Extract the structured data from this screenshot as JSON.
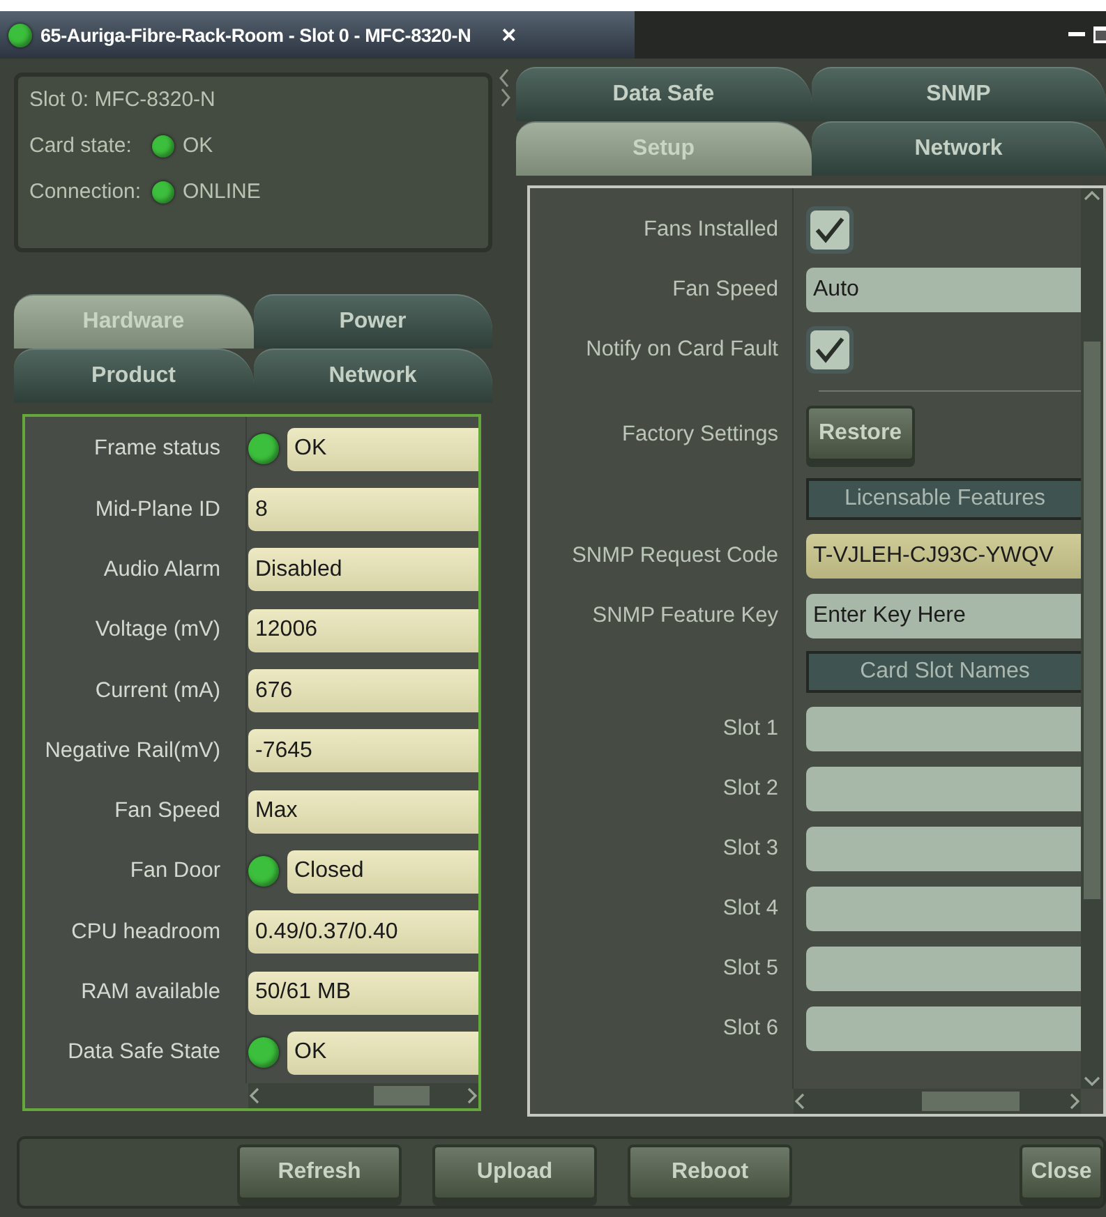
{
  "window": {
    "title": "65-Auriga-Fibre-Rack-Room - Slot 0 - MFC-8320-N",
    "ok": true,
    "close": "×"
  },
  "card_info": {
    "title": "Slot 0: MFC-8320-N",
    "items": [
      {
        "label": "Card state:",
        "value": "OK",
        "ok": true
      },
      {
        "label": "Connection:",
        "value": "ONLINE",
        "ok": true
      }
    ]
  },
  "left_tabs": [
    [
      {
        "label": "Hardware",
        "selected": true
      },
      {
        "label": "Power",
        "selected": false
      }
    ],
    [
      {
        "label": "Product",
        "selected": false
      },
      {
        "label": "Network",
        "selected": false
      }
    ]
  ],
  "hardware_rows": [
    {
      "label": "Frame status",
      "value": "OK",
      "ok": true
    },
    {
      "label": "Mid-Plane ID",
      "value": "8"
    },
    {
      "label": "Audio Alarm",
      "value": "Disabled"
    },
    {
      "label": "Voltage (mV)",
      "value": "12006"
    },
    {
      "label": "Current (mA)",
      "value": "676"
    },
    {
      "label": "Negative Rail(mV)",
      "value": "-7645"
    },
    {
      "label": "Fan Speed",
      "value": "Max"
    },
    {
      "label": "Fan Door",
      "value": "Closed",
      "ok": true
    },
    {
      "label": "CPU headroom",
      "value": "0.49/0.37/0.40"
    },
    {
      "label": "RAM available",
      "value": "50/61 MB"
    },
    {
      "label": "Data Safe State",
      "value": "OK",
      "ok": true
    }
  ],
  "right_tabs": [
    [
      {
        "label": "Data Safe",
        "selected": false
      },
      {
        "label": "SNMP",
        "selected": false
      }
    ],
    [
      {
        "label": "Setup",
        "selected": true
      },
      {
        "label": "Network",
        "selected": false
      }
    ]
  ],
  "setup_rows": [
    {
      "kind": "checkbox",
      "label": "Fans Installed",
      "checked": true
    },
    {
      "kind": "field",
      "label": "Fan Speed",
      "value": "Auto"
    },
    {
      "kind": "checkbox",
      "label": "Notify on Card Fault",
      "checked": true
    },
    {
      "kind": "divider"
    },
    {
      "kind": "button",
      "label": "Factory Settings",
      "button": "Restore"
    },
    {
      "kind": "header",
      "text": "Licensable Features"
    },
    {
      "kind": "code",
      "label": "SNMP Request Code",
      "value": "T-VJLEH-CJ93C-YWQV"
    },
    {
      "kind": "field",
      "label": "SNMP Feature Key",
      "value": "Enter Key Here"
    },
    {
      "kind": "header",
      "text": "Card Slot Names"
    },
    {
      "kind": "field",
      "label": "Slot 1"
    },
    {
      "kind": "field",
      "label": "Slot 2"
    },
    {
      "kind": "field",
      "label": "Slot 3"
    },
    {
      "kind": "field",
      "label": "Slot 4"
    },
    {
      "kind": "field",
      "label": "Slot 5"
    },
    {
      "kind": "field",
      "label": "Slot 6"
    }
  ],
  "buttons": [
    "Refresh",
    "Upload",
    "Reboot",
    "Close"
  ]
}
